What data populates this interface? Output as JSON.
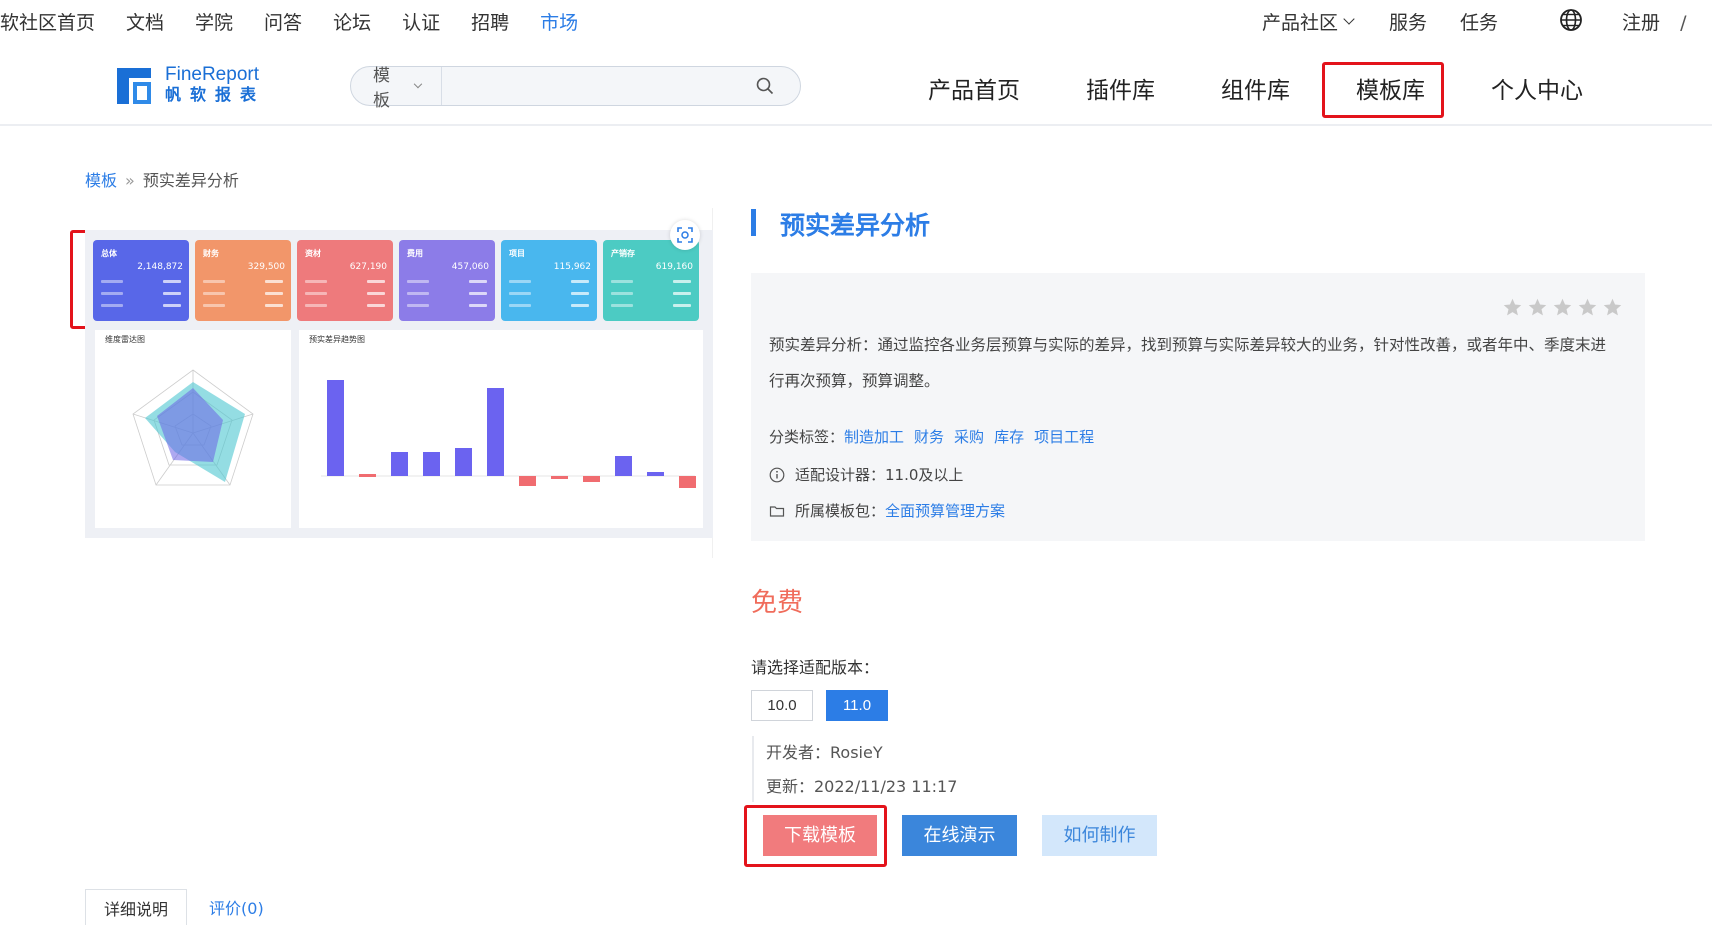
{
  "topnav": {
    "left": [
      "软社区首页",
      "文档",
      "学院",
      "问答",
      "论坛",
      "认证",
      "招聘",
      "市场"
    ],
    "active_index": 7,
    "right": {
      "product_community": "产品社区",
      "service": "服务",
      "task": "任务",
      "register": "注册",
      "separator": "/"
    }
  },
  "header": {
    "logo_en": "FineReport",
    "logo_cn": "帆软报表",
    "search_scope": "模板",
    "search_placeholder": "",
    "nav": [
      "产品首页",
      "插件库",
      "组件库",
      "模板库",
      "个人中心"
    ],
    "active_nav": "模板库"
  },
  "breadcrumb": {
    "parent": "模板",
    "separator": "»",
    "current": "预实差异分析"
  },
  "preview": {
    "cards": [
      {
        "title": "总体",
        "value": "2,148,872",
        "color": "#5867e8"
      },
      {
        "title": "财务",
        "value": "329,500",
        "color": "#f2966a"
      },
      {
        "title": "资材",
        "value": "627,190",
        "color": "#ee7a7c"
      },
      {
        "title": "费用",
        "value": "457,060",
        "color": "#8c7ce8"
      },
      {
        "title": "项目",
        "value": "115,962",
        "color": "#49b7ee"
      },
      {
        "title": "产销存",
        "value": "619,160",
        "color": "#4ccbc3"
      }
    ],
    "radar_title": "维度雷达图",
    "bar_title": "预实差异趋势图"
  },
  "detail": {
    "title": "预实差异分析",
    "rating_stars": 5,
    "description": "预实差异分析：通过监控各业务层预算与实际的差异，找到预算与实际差异较大的业务，针对性改善，或者年中、季度末进行再次预算，预算调整。",
    "tags_label": "分类标签：",
    "tags": [
      "制造加工",
      "财务",
      "采购",
      "库存",
      "项目工程"
    ],
    "designer_label": "适配设计器：11.0及以上",
    "package_label": "所属模板包：",
    "package_link": "全面预算管理方案",
    "price": "免费",
    "version_label": "请选择适配版本：",
    "versions": [
      "10.0",
      "11.0"
    ],
    "selected_version": "11.0",
    "developer": "开发者：RosieY",
    "updated": "更新：2022/11/23 11:17",
    "buttons": {
      "download": "下载模板",
      "demo": "在线演示",
      "howto": "如何制作"
    }
  },
  "tabs": [
    "详细说明",
    "评价(0)"
  ],
  "colors": {
    "accent": "#2c7de6",
    "highlight": "#e3131b",
    "price": "#f06c5b",
    "download": "#f17b7d"
  }
}
